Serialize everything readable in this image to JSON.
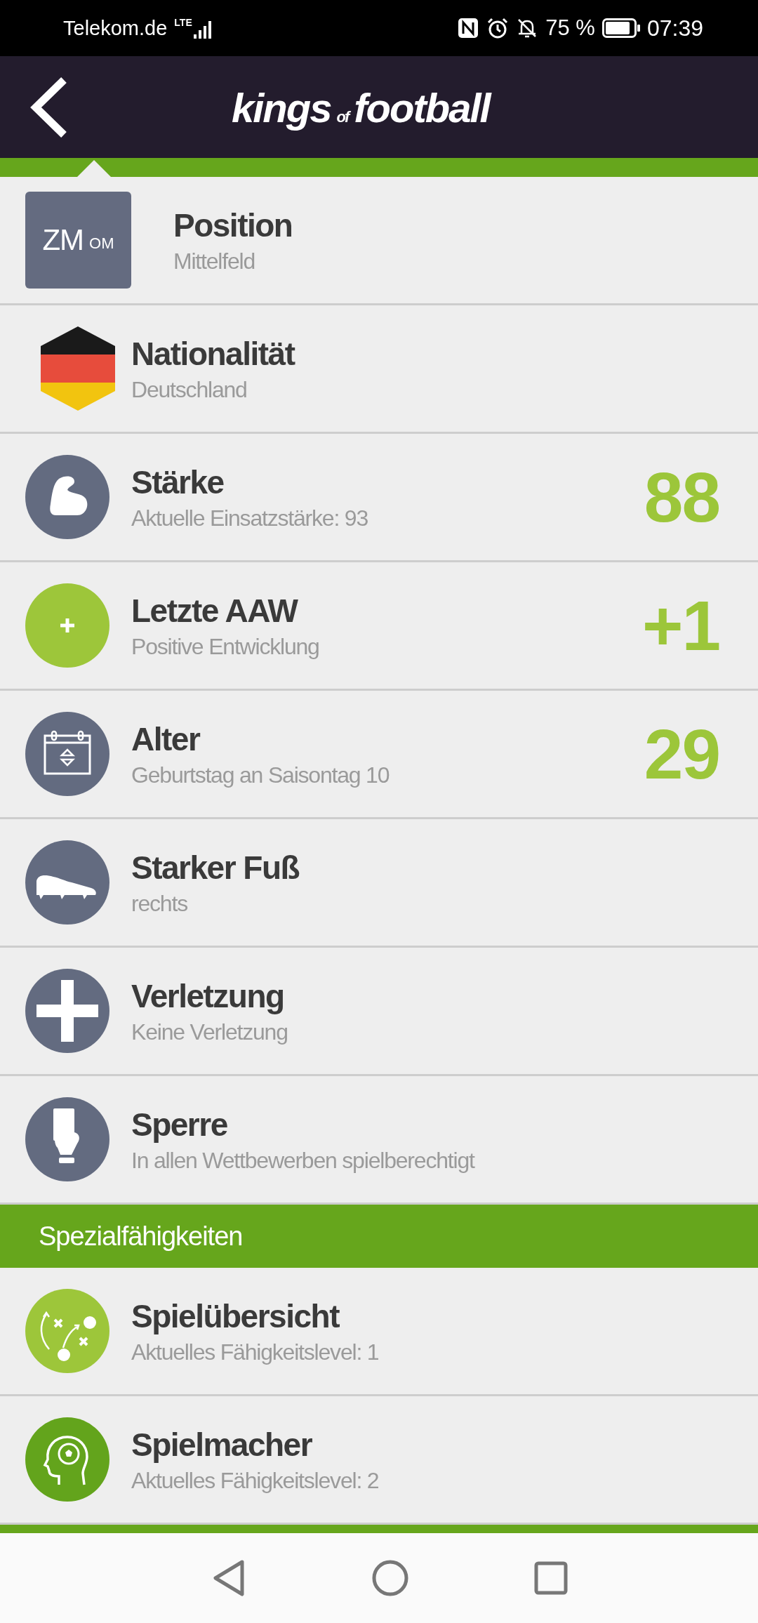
{
  "status_bar": {
    "carrier": "Telekom.de",
    "network": "LTE",
    "battery": "75 %",
    "time": "07:39"
  },
  "header": {
    "logo_words": [
      "kings",
      "of",
      "football"
    ]
  },
  "rows": [
    {
      "kind": "position",
      "badge_main": "ZM",
      "badge_sub": "OM",
      "title": "Position",
      "subtitle": "Mittelfeld"
    },
    {
      "kind": "flag",
      "title": "Nationalität",
      "subtitle": "Deutschland"
    },
    {
      "kind": "muscle",
      "title": "Stärke",
      "subtitle": "Aktuelle Einsatzstärke: 93",
      "value": "88"
    },
    {
      "kind": "plus",
      "title": "Letzte AAW",
      "subtitle": "Positive Entwicklung",
      "value": "+1"
    },
    {
      "kind": "calendar",
      "title": "Alter",
      "subtitle": "Geburtstag an Saisontag 10",
      "value": "29"
    },
    {
      "kind": "boot",
      "title": "Starker Fuß",
      "subtitle": "rechts"
    },
    {
      "kind": "cross",
      "title": "Verletzung",
      "subtitle": "Keine Verletzung"
    },
    {
      "kind": "card",
      "title": "Sperre",
      "subtitle": "In allen Wettbewerben spielberechtigt"
    }
  ],
  "section": {
    "title": "Spezialfähigkeiten",
    "rows": [
      {
        "kind": "tactics",
        "title": "Spielübersicht",
        "subtitle": "Aktuelles Fähigkeitslevel: 1"
      },
      {
        "kind": "head",
        "title": "Spielmacher",
        "subtitle": "Aktuelles Fähigkeitslevel: 2"
      }
    ]
  }
}
